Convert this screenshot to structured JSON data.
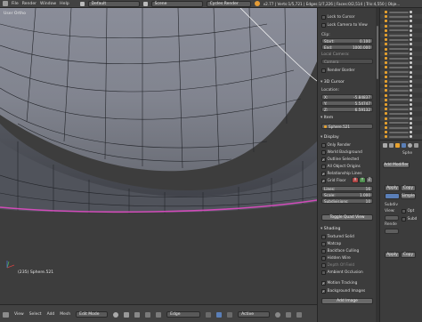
{
  "topbar": {
    "menus": [
      "File",
      "Render",
      "Window",
      "Help"
    ],
    "screen_layout": "Default",
    "scene": "Scene",
    "engine": "Cycles Render",
    "stats": "v2.77 | Verts:1/5,721 | Edges:1/7,226 | Faces:0/2,514 | Tris:4,550 | Obje..."
  },
  "viewport": {
    "label": "User Ortho",
    "status": "(235) Sphere.521",
    "footer": {
      "menus": [
        "View",
        "Select",
        "Add",
        "Mesh"
      ],
      "mode": "Edit Mode",
      "pivot": "Edge",
      "orientation": "Active"
    }
  },
  "properties": {
    "lock_cursor": "Lock to Cursor",
    "lock_camera": "Lock Camera to View",
    "clip_header": "Clip:",
    "clip_start_label": "Start:",
    "clip_start": "0.100",
    "clip_end_label": "End:",
    "clip_end": "1000.000",
    "local_camera": "Local Camera:",
    "camera": "Camera",
    "render_border": "Render Border",
    "cursor_section": "3D Cursor",
    "location_label": "Location:",
    "x_label": "X:",
    "x_val": "-5.84837",
    "y_label": "Y:",
    "y_val": "5.54747",
    "z_label": "Z:",
    "z_val": "6.59132",
    "item_section": "Item",
    "item_name": "Sphere.521",
    "display_section": "Display",
    "only_render": "Only Render",
    "world_background": "World Background",
    "outline_selected": "Outline Selected",
    "all_object_origins": "All Object Origins",
    "relationship_lines": "Relationship Lines",
    "grid_floor": "Grid Floor",
    "x_axis": "X",
    "y_axis": "Y",
    "z_axis": "Z",
    "lines_label": "Lines:",
    "lines_val": "16",
    "scale_label": "Scale:",
    "scale_val": "1.000",
    "subdiv_label": "Subdivisions:",
    "subdiv_val": "10",
    "toggle_quad": "Toggle Quad View",
    "shading_section": "Shading",
    "textured_solid": "Textured Solid",
    "matcap": "Matcap",
    "backface": "Backface Culling",
    "hidden_wire": "Hidden Wire",
    "depth_of_field": "Depth Of Field",
    "ambient_occlusion": "Ambient Occlusion",
    "motion_tracking": "Motion Tracking",
    "background_images": "Background Images",
    "add_image": "Add Image"
  },
  "modifiers": {
    "add_modifier": "Add Modifier",
    "apply": "Apply",
    "copy": "Copy",
    "tab_simple": "Simple",
    "subdiv_label": "Subdiv",
    "view_label": "View:",
    "render_label": "Rende",
    "opt": "Opt",
    "subd": "Subd",
    "apply2": "Apply",
    "copy2": "Copy",
    "spline": "Sphe"
  },
  "outliner": {
    "rows": 28
  },
  "colors": {
    "edge_highlight": "#d14bb8",
    "selected_orange": "#e7a12e",
    "panel": "#3c3c3c"
  }
}
